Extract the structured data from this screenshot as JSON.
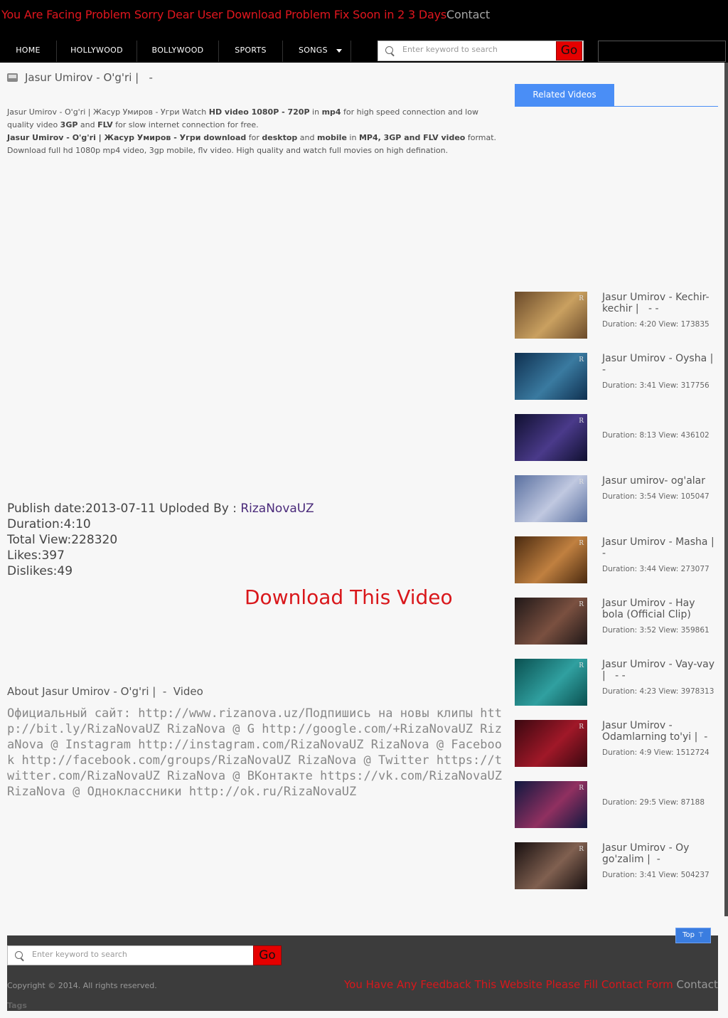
{
  "header": {
    "announcement": "You Are Facing Problem Sorry Dear User Download Problem Fix Soon in 2 3 Days",
    "contact_link": "Contact"
  },
  "nav": {
    "items": [
      "HOME",
      "HOLLYWOOD",
      "BOLLYWOOD",
      "SPORTS",
      "SONGS"
    ]
  },
  "search": {
    "placeholder": "Enter keyword to search",
    "go_label": "Go"
  },
  "video": {
    "title": "Jasur Umirov - O'g'ri |   -",
    "description_parts": {
      "p1_a": "Jasur Umirov - O'g'ri | Жасур Умиров - Угри Watch ",
      "p1_b": "HD video 1080P - 720P",
      "p1_c": " in ",
      "p1_d": "mp4",
      "p1_e": " for high speed connection and low quality video ",
      "p1_f": "3GP",
      "p1_g": " and ",
      "p1_h": "FLV",
      "p1_i": " for slow internet connection for free.",
      "p2_a": "Jasur Umirov - O'g'ri | Жасур Умиров - Угри download",
      "p2_b": " for ",
      "p2_c": "desktop",
      "p2_d": " and ",
      "p2_e": "mobile",
      "p2_f": " in ",
      "p2_g": "MP4, 3GP and FLV video",
      "p2_h": " format. Download full hd 1080p mp4 video, 3gp mobile, flv video. High quality and watch full movies on high defination."
    },
    "publish_label": "Publish date:2013-07-11 Uploded By : ",
    "uploader": "RizaNovaUZ",
    "duration": "Duration:4:10",
    "total_view": "Total View:228320",
    "likes": "Likes:397",
    "dislikes": "Dislikes:49",
    "download_label": "Download This Video",
    "about_title": "About Jasur Umirov - O'g'ri |  -  Video",
    "about_body": "Официальный сайт: http://www.rizanova.uz/Подпишись на новы клипы http://bit.ly/RizaNovaUZ RizaNova @ G http://google.com/+RizaNovaUZ RizaNova @ Instagram http://instagram.com/RizaNovaUZ RizaNova @ Facebook http://facebook.com/groups/RizaNovaUZ RizaNova @ Twitter https://twitter.com/RizaNovaUZ RizaNova @ ВКонтакте https://vk.com/RizaNovaUZ RizaNova @ Одноклассники http://ok.ru/RizaNovaUZ"
  },
  "related": {
    "tab_label": "Related Videos",
    "items": [
      {
        "title": "Jasur Umirov - Kechir-kechir |   - -",
        "meta": "Duration: 4:20 View: 173835",
        "colors": [
          "#6a4a2a",
          "#c9a060"
        ]
      },
      {
        "title": "Jasur Umirov - Oysha |  -",
        "meta": "Duration: 3:41 View: 317756",
        "colors": [
          "#0f3050",
          "#3a7aa0"
        ]
      },
      {
        "title": "",
        "meta": "Duration: 8:13 View: 436102",
        "colors": [
          "#101030",
          "#4a3a8a"
        ]
      },
      {
        "title": "Jasur umirov- og'alar",
        "meta": "Duration: 3:54 View: 105047",
        "colors": [
          "#5a70a0",
          "#c0c8e0"
        ]
      },
      {
        "title": "Jasur Umirov - Masha |  -",
        "meta": "Duration: 3:44 View: 273077",
        "colors": [
          "#4a2a10",
          "#c08040"
        ]
      },
      {
        "title": "Jasur Umirov - Hay bola (Official Clip)",
        "meta": "Duration: 3:52 View: 359861",
        "colors": [
          "#201818",
          "#7a5040"
        ]
      },
      {
        "title": "Jasur Umirov - Vay-vay |   - -",
        "meta": "Duration: 4:23 View: 3978313",
        "colors": [
          "#0a5050",
          "#30a0a0"
        ]
      },
      {
        "title": "Jasur Umirov - Odamlarning to'yi |  -",
        "meta": "Duration: 4:9 View: 1512724",
        "colors": [
          "#3a0810",
          "#a01828"
        ]
      },
      {
        "title": "",
        "meta": "Duration: 29:5 View: 87188",
        "colors": [
          "#101840",
          "#903060"
        ]
      },
      {
        "title": "Jasur Umirov - Oy go'zalim |  -",
        "meta": "Duration: 3:41 View: 504237",
        "colors": [
          "#181010",
          "#806050"
        ]
      }
    ]
  },
  "footer": {
    "top_label": "Top",
    "copyright": "Copyright © 2014. All rights reserved.",
    "feedback_text": "You Have Any Feedback This Website Please Fill Contact Form ",
    "feedback_contact": "Contact",
    "tags_label": "Tags"
  }
}
